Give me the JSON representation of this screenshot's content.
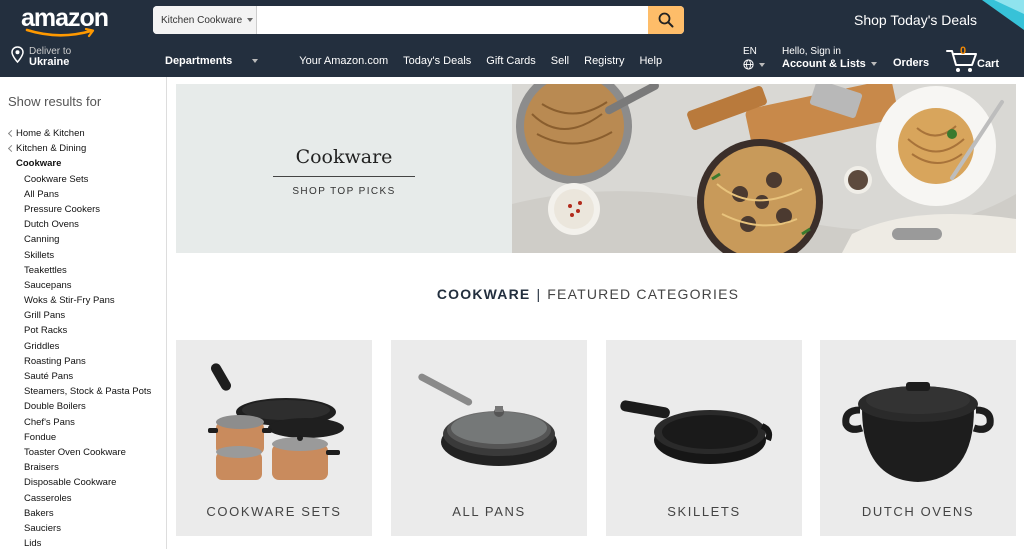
{
  "header": {
    "logo_text": "amazon",
    "search": {
      "category": "Kitchen Cookware",
      "value": "",
      "placeholder": ""
    },
    "promo": "Shop Today's Deals"
  },
  "subnav": {
    "deliver_small": "Deliver to",
    "deliver_big": "Ukraine",
    "links": [
      "Your Amazon.com",
      "Today's Deals",
      "Gift Cards",
      "Sell",
      "Registry",
      "Help"
    ],
    "departments": "Departments",
    "lang": "EN",
    "account_small": "Hello, Sign in",
    "account_big": "Account & Lists",
    "orders": "Orders",
    "cart_count": "0",
    "cart_label": "Cart"
  },
  "sidebar": {
    "heading": "Show results for",
    "parents": [
      "Home & Kitchen",
      "Kitchen & Dining"
    ],
    "current": "Cookware",
    "children": [
      "Cookware Sets",
      "All Pans",
      "Pressure Cookers",
      "Dutch Ovens",
      "Canning",
      "Skillets",
      "Teakettles",
      "Saucepans",
      "Woks & Stir-Fry Pans",
      "Grill Pans",
      "Pot Racks",
      "Griddles",
      "Roasting Pans",
      "Sauté Pans",
      "Steamers, Stock & Pasta Pots",
      "Double Boilers",
      "Chef's Pans",
      "Fondue",
      "Toaster Oven Cookware",
      "Braisers",
      "Disposable Cookware",
      "Casseroles",
      "Bakers",
      "Sauciers",
      "Lids"
    ]
  },
  "hero": {
    "title": "Cookware",
    "subtitle": "SHOP TOP PICKS"
  },
  "featured": {
    "title_a": "COOKWARE",
    "separator": "|",
    "title_b": "FEATURED CATEGORIES",
    "tiles": [
      {
        "label": "COOKWARE SETS",
        "icon": "cookware-set-image"
      },
      {
        "label": "ALL PANS",
        "icon": "frying-pan-with-lid-image"
      },
      {
        "label": "SKILLETS",
        "icon": "cast-iron-skillet-image"
      },
      {
        "label": "DUTCH OVENS",
        "icon": "dutch-oven-image"
      }
    ]
  },
  "colors": {
    "nav_bg": "#232f3e",
    "search_button": "#febd69",
    "cart_count": "#f08804",
    "hero_panel": "#e7ebea",
    "tile_bg": "#ebebeb"
  }
}
